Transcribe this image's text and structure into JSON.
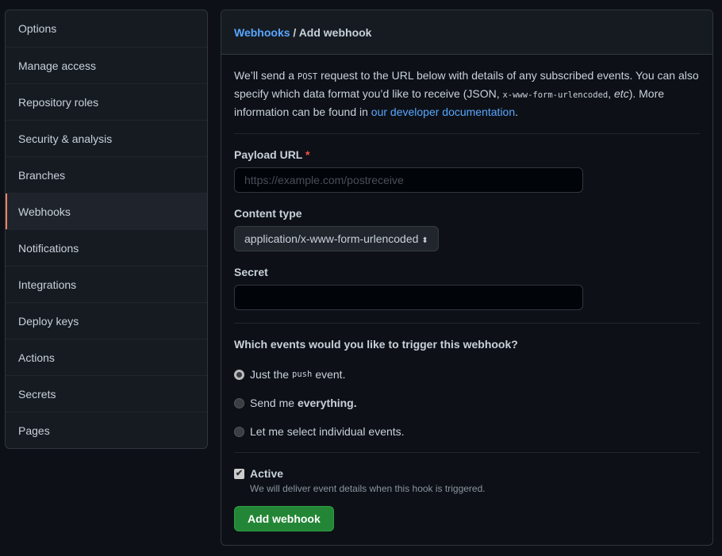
{
  "sidebar": {
    "items": [
      {
        "label": "Options"
      },
      {
        "label": "Manage access"
      },
      {
        "label": "Repository roles"
      },
      {
        "label": "Security & analysis"
      },
      {
        "label": "Branches"
      },
      {
        "label": "Webhooks",
        "active": true
      },
      {
        "label": "Notifications"
      },
      {
        "label": "Integrations"
      },
      {
        "label": "Deploy keys"
      },
      {
        "label": "Actions"
      },
      {
        "label": "Secrets"
      },
      {
        "label": "Pages"
      }
    ]
  },
  "header": {
    "crumb": "Webhooks",
    "sep": " / ",
    "title": "Add webhook"
  },
  "intro": {
    "t1": "We’ll send a ",
    "post": "POST",
    "t2": " request to the URL below with details of any subscribed events. You can also specify which data format you’d like to receive (JSON, ",
    "fmt": "x-www-form-urlencoded",
    "t3": ", ",
    "etc": "etc",
    "t4": "). More information can be found in ",
    "link": "our developer documentation",
    "t5": "."
  },
  "form": {
    "payload_label": "Payload URL",
    "required": "*",
    "payload_placeholder": "https://example.com/postreceive",
    "payload_value": "",
    "content_label": "Content type",
    "content_value": "application/x-www-form-urlencoded",
    "secret_label": "Secret",
    "secret_value": "",
    "events_question": "Which events would you like to trigger this webhook?",
    "opt1": {
      "a": "Just the ",
      "code": "push",
      "b": " event.",
      "checked": true
    },
    "opt2": {
      "a": "Send me ",
      "b": "everything.",
      "checked": false
    },
    "opt3": {
      "a": "Let me select individual events.",
      "checked": false
    },
    "active_label": "Active",
    "active_checked": true,
    "active_note": "We will deliver event details when this hook is triggered.",
    "submit": "Add webhook"
  },
  "colors": {
    "accent": "#58a6ff",
    "active_marker": "#f78166",
    "button": "#238636"
  }
}
